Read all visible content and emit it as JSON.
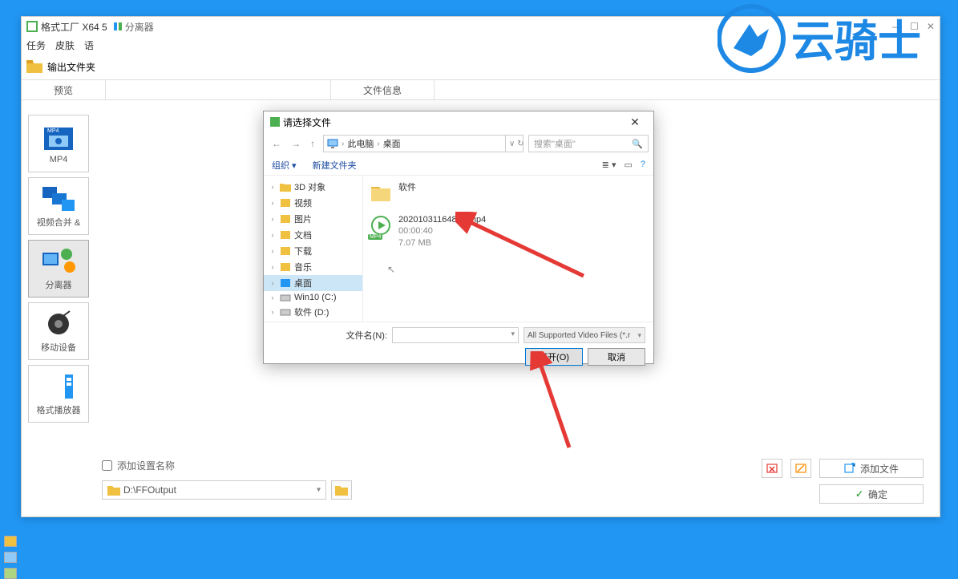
{
  "main": {
    "title": "格式工厂 X64 5",
    "title2": "分离器",
    "menu": [
      "任务",
      "皮肤",
      "语"
    ],
    "output_label": "输出文件夹",
    "tabs": {
      "preview": "预览",
      "fileinfo": "文件信息"
    }
  },
  "sidebar": {
    "tiles": [
      {
        "label": "MP4"
      },
      {
        "label": "视频合并 &"
      },
      {
        "label": "分离器"
      },
      {
        "label": "移动设备"
      },
      {
        "label": "格式播放器"
      }
    ]
  },
  "bottom": {
    "checkbox_label": "添加设置名称",
    "path": "D:\\FFOutput",
    "add_file": "添加文件",
    "ok": "确定"
  },
  "dialog": {
    "title": "请选择文件",
    "breadcrumb": {
      "pc": "此电脑",
      "desktop": "桌面"
    },
    "search_placeholder": "搜索\"桌面\"",
    "toolbar": {
      "organize": "组织",
      "new_folder": "新建文件夹"
    },
    "tree": [
      {
        "label": "3D 对象"
      },
      {
        "label": "视频"
      },
      {
        "label": "图片"
      },
      {
        "label": "文档"
      },
      {
        "label": "下载"
      },
      {
        "label": "音乐"
      },
      {
        "label": "桌面",
        "selected": true
      },
      {
        "label": "Win10 (C:)"
      },
      {
        "label": "软件 (D:)"
      }
    ],
    "files": {
      "folder": "软件",
      "video": {
        "name": "20201031164822.mp4",
        "duration": "00:00:40",
        "size": "7.07 MB",
        "badge": "MP4"
      }
    },
    "filename_label": "文件名(N):",
    "filter": "All Supported Video Files (*.r",
    "open": "打开(O)",
    "cancel": "取消"
  }
}
